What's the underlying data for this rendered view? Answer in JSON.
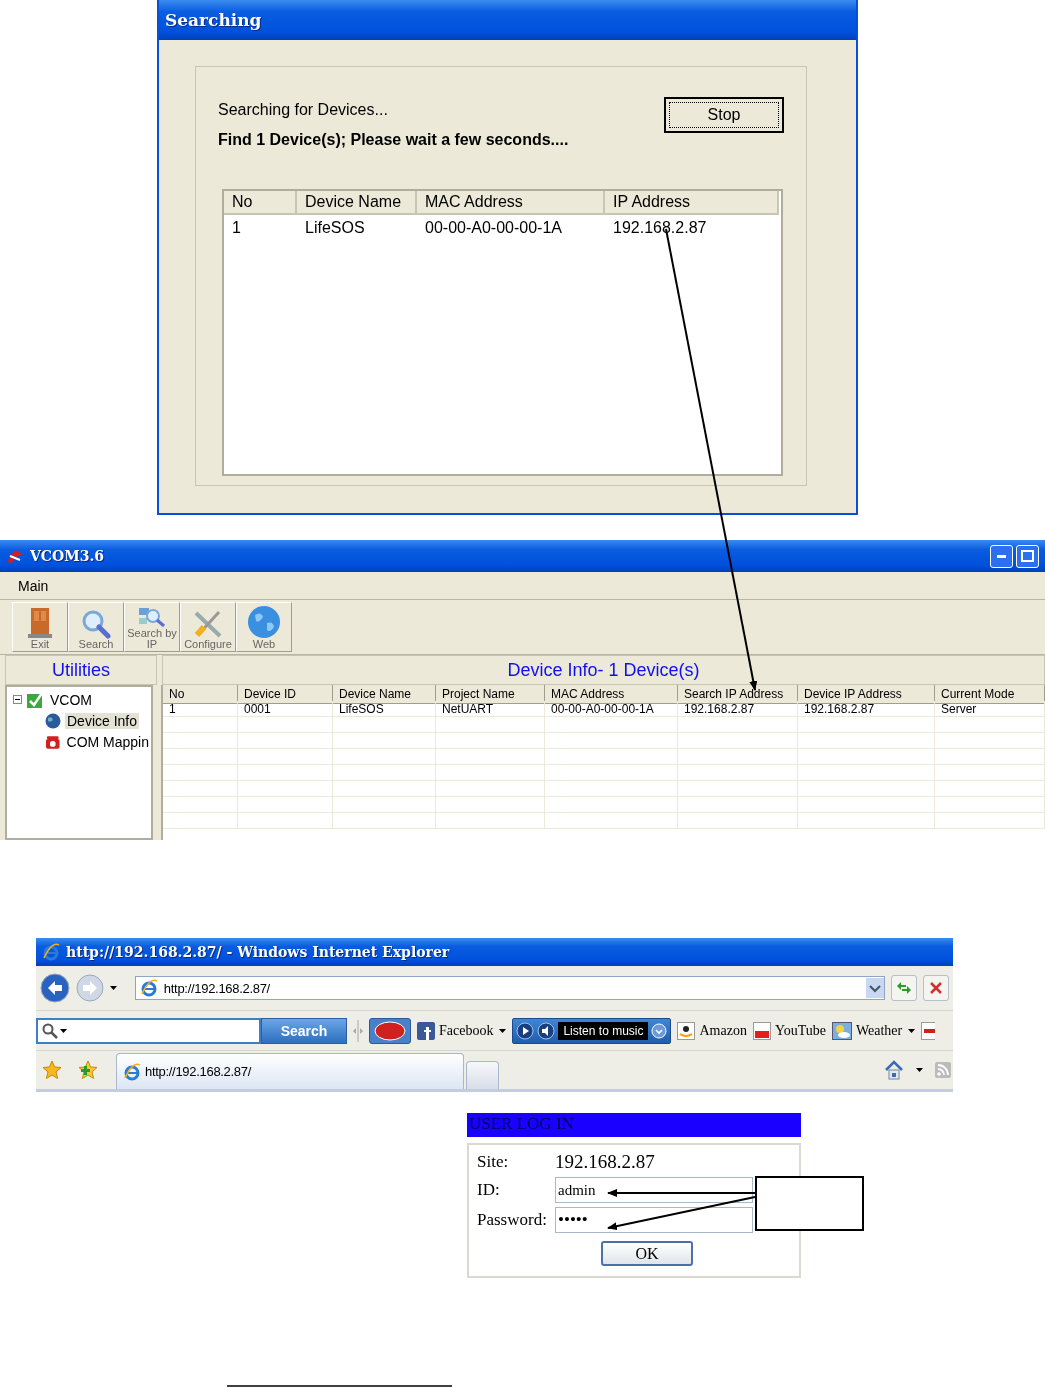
{
  "search_dialog": {
    "title": "Searching",
    "status": "Searching for  Devices...",
    "found_message": "Find 1 Device(s);  Please wait a few seconds....",
    "stop_button": "Stop",
    "columns": [
      "No",
      "Device Name",
      "MAC Address",
      "IP Address"
    ],
    "rows": [
      [
        "1",
        "LifeSOS",
        "00-00-A0-00-00-1A",
        "192.168.2.87"
      ]
    ]
  },
  "vcom": {
    "title": "VCOM3.6",
    "menu": [
      "Main"
    ],
    "toolbar": [
      {
        "kind": "door",
        "label": "Exit"
      },
      {
        "kind": "search",
        "label": "Search"
      },
      {
        "kind": "search_ip",
        "label": "Search by IP"
      },
      {
        "kind": "tools",
        "label": "Configure"
      },
      {
        "kind": "globe",
        "label": "Web"
      }
    ],
    "sidebar_title": "Utilities",
    "tree": [
      {
        "label": "VCOM",
        "expanded": true,
        "children": [
          {
            "label": "Device Info",
            "kind": "globe",
            "selected": true
          },
          {
            "label": "COM Mappin",
            "kind": "phone",
            "selected": false
          }
        ]
      }
    ],
    "table_title": "Device Info- 1 Device(s)",
    "columns": [
      "No",
      "Device ID",
      "Device Name",
      "Project Name",
      "MAC Address",
      "Search IP Address",
      "Device IP Address",
      "Current Mode"
    ],
    "rows": [
      [
        "1",
        "0001",
        "LifeSOS",
        "NetUART",
        "00-00-A0-00-00-1A",
        "192.168.2.87",
        "192.168.2.87",
        "Server"
      ]
    ]
  },
  "browser": {
    "title": "http://192.168.2.87/ - Windows Internet Explorer",
    "address": "http://192.168.2.87/",
    "search_button": "Search",
    "links": [
      {
        "kind": "facebook",
        "label": "Facebook",
        "menu": true
      },
      {
        "kind": "music",
        "label": "Listen to music",
        "menu": true
      },
      {
        "kind": "amazon",
        "label": "Amazon",
        "menu": false
      },
      {
        "kind": "youtube",
        "label": "YouTube",
        "menu": false
      },
      {
        "kind": "weather",
        "label": "Weather",
        "menu": true
      }
    ],
    "tab": "http://192.168.2.87/"
  },
  "login": {
    "title": "USER LOG IN",
    "site_label": "Site:",
    "site": "192.168.2.87",
    "id_label": "ID:",
    "id_value": "admin",
    "password_label": "Password:",
    "password_value": "•••••",
    "ok_button": "OK"
  }
}
